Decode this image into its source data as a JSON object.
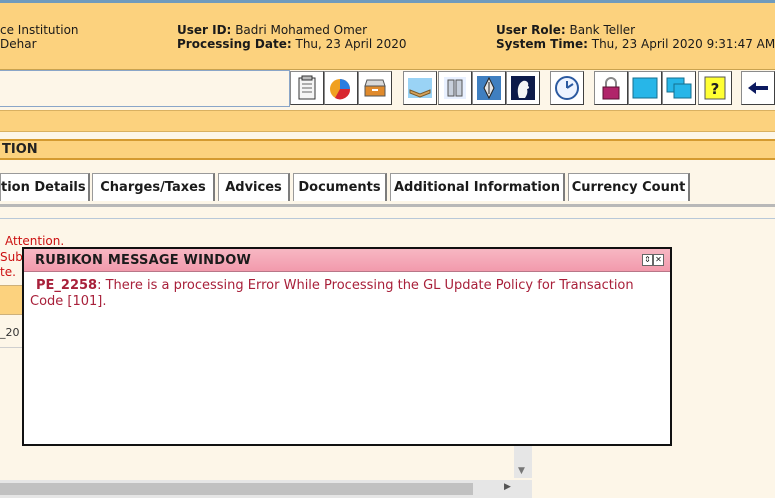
{
  "header": {
    "institution": "ce Institution",
    "branch": "Dehar",
    "user_id_label": "User ID:",
    "user_id_value": "Badri Mohamed Omer",
    "processing_date_label": "Processing Date:",
    "processing_date_value": "Thu, 23 April 2020",
    "user_role_label": "User Role:",
    "user_role_value": "Bank Teller",
    "system_time_label": "System Time:",
    "system_time_value": "Thu, 23 April 2020 9:31:47 AM"
  },
  "toolbar": {
    "icons": [
      "notepad-icon",
      "pie-chart-icon",
      "drawer-icon",
      "book-icon",
      "database-icon",
      "pen-icon",
      "profile-icon",
      "clock-icon",
      "lock-icon",
      "window-icon",
      "windows-icon",
      "help-icon",
      "back-arrow-icon"
    ]
  },
  "section": {
    "title": "TION"
  },
  "tabs": [
    {
      "label": "tion Details"
    },
    {
      "label": "Charges/Taxes"
    },
    {
      "label": "Advices"
    },
    {
      "label": "Documents"
    },
    {
      "label": "Additional Information"
    },
    {
      "label": "Currency Count"
    }
  ],
  "background": {
    "attention": "Attention.",
    "subm": "Subr",
    "te": "te.",
    "cell": "_20"
  },
  "modal": {
    "title": "RUBIKON MESSAGE WINDOW",
    "code": "PE_2258",
    "message": ": There is a processing Error While Processing the GL Update Policy for Transaction Code [101]."
  },
  "colors": {
    "header_bg": "#fcd27e",
    "modal_title_bg": "#f29aac",
    "error_text": "#a8203a",
    "attention_text": "#cc1111"
  }
}
